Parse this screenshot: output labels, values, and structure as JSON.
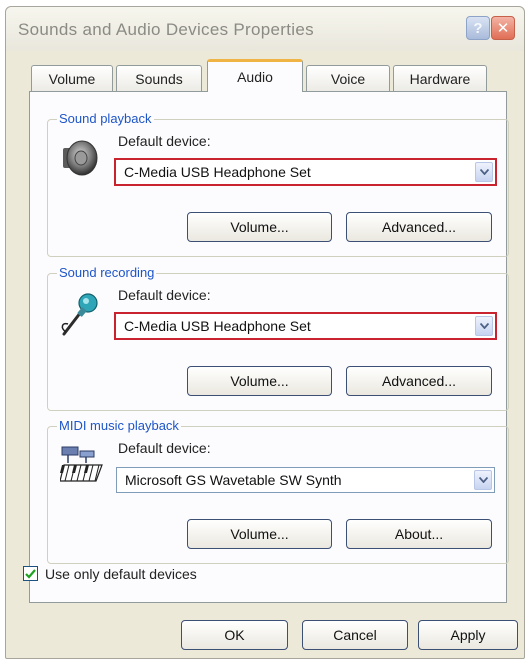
{
  "window": {
    "title": "Sounds and Audio Devices Properties",
    "help_label": "?",
    "close_label": "✕"
  },
  "tabs": [
    {
      "label": "Volume",
      "active": false
    },
    {
      "label": "Sounds",
      "active": false
    },
    {
      "label": "Audio",
      "active": true
    },
    {
      "label": "Voice",
      "active": false
    },
    {
      "label": "Hardware",
      "active": false
    }
  ],
  "sound_playback": {
    "group_label": "Sound playback",
    "icon": "speaker-icon",
    "device_label": "Default device:",
    "device_value": "C-Media USB Headphone Set",
    "volume_label": "Volume...",
    "advanced_label": "Advanced..."
  },
  "sound_recording": {
    "group_label": "Sound recording",
    "icon": "microphone-icon",
    "device_label": "Default device:",
    "device_value": "C-Media USB Headphone Set",
    "volume_label": "Volume...",
    "advanced_label": "Advanced..."
  },
  "midi_playback": {
    "group_label": "MIDI music playback",
    "icon": "midi-keyboard-icon",
    "device_label": "Default device:",
    "device_value": "Microsoft GS Wavetable SW Synth",
    "volume_label": "Volume...",
    "about_label": "About..."
  },
  "use_default_devices": {
    "label": "Use only default devices",
    "checked": true
  },
  "footer": {
    "ok_label": "OK",
    "cancel_label": "Cancel",
    "apply_label": "Apply"
  },
  "colors": {
    "highlight_border": "#c8232e",
    "group_label": "#1e55c8",
    "active_tab_accent": "#f0b444"
  }
}
